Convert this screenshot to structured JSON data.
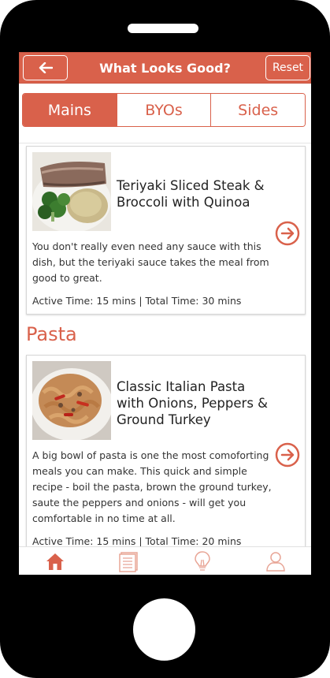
{
  "header": {
    "back_icon": "left-arrow-icon",
    "title": "What Looks Good?",
    "reset_label": "Reset"
  },
  "tabs": [
    {
      "label": "Mains",
      "active": true
    },
    {
      "label": "BYOs",
      "active": false
    },
    {
      "label": "Sides",
      "active": false
    }
  ],
  "cards": [
    {
      "title": "Teriyaki Sliced Steak & Broccoli with Quinoa",
      "description": "You don't really even need any sauce with this dish, but the teriyaki sauce takes the meal from good to great.",
      "time": "Active Time: 15 mins | Total Time: 30 mins",
      "image": "steak-broccoli-quinoa-photo"
    },
    {
      "title": "Classic Italian Pasta with Onions, Peppers & Ground Turkey",
      "description": "A big bowl of pasta is one the most comoforting meals you can make. This quick and simple recipe - boil the pasta, brown the ground turkey, saute the peppers and onions - will get you comfortable in no time at all.",
      "time": "Active Time: 15 mins | Total Time: 20 mins",
      "image": "pasta-turkey-peppers-photo"
    }
  ],
  "sections": {
    "pasta_title": "Pasta"
  },
  "bottom_nav": [
    {
      "icon": "home-icon",
      "active": true
    },
    {
      "icon": "list-icon",
      "active": false
    },
    {
      "icon": "lightbulb-icon",
      "active": false
    },
    {
      "icon": "user-icon",
      "active": false
    }
  ],
  "colors": {
    "accent": "#d9614b",
    "nav_inactive": "#e8a596"
  }
}
